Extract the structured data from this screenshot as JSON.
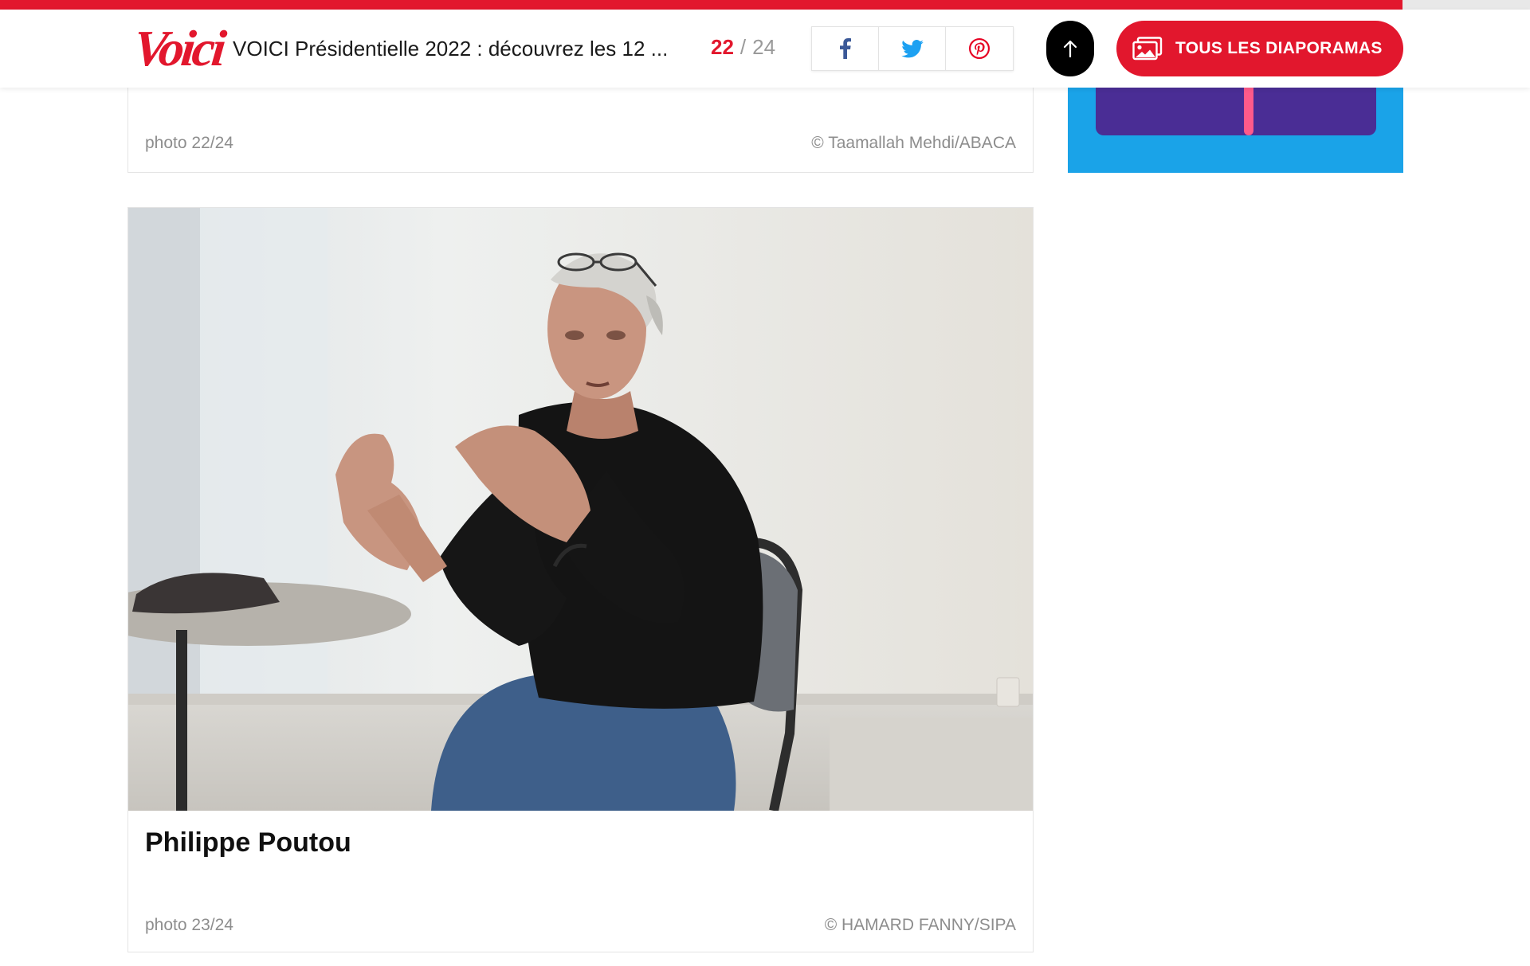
{
  "progress": {
    "fraction": 0.9167
  },
  "header": {
    "logo": "Voici",
    "title": "VOICI Présidentielle 2022 : découvrez les 12 ...",
    "counter": {
      "current": "22",
      "separator": "/",
      "total": "24"
    },
    "share": [
      {
        "icon": "facebook-icon",
        "color": "#3b5998"
      },
      {
        "icon": "twitter-icon",
        "color": "#1da1f2"
      },
      {
        "icon": "pinterest-icon",
        "color": "#e60023"
      }
    ],
    "back_to_top_icon": "arrow-up-icon",
    "all_slideshows_label": "TOUS LES DIAPORAMAS",
    "all_slideshows_icon": "gallery-icon"
  },
  "previous_slide": {
    "photo_label": "photo 22/24",
    "credit": "© Taamallah Mehdi/ABACA"
  },
  "current_slide": {
    "caption": "Philippe Poutou",
    "photo_label": "photo 23/24",
    "credit": "© HAMARD FANNY/SIPA"
  },
  "colors": {
    "brand": "#e2172d",
    "ad_background": "#1aa3e8"
  }
}
